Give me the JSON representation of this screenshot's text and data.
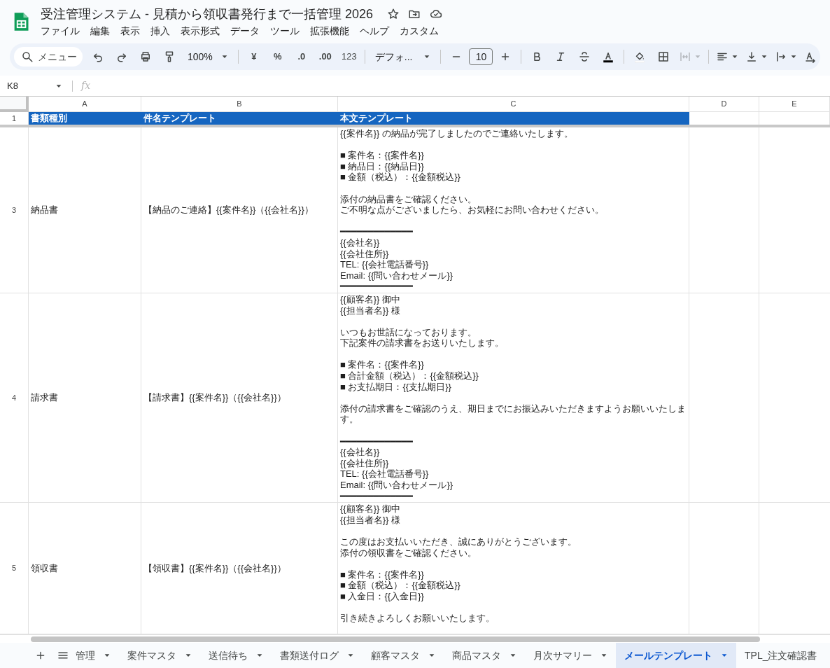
{
  "doc_title": "受注管理システム - 見積から領収書発行まで一括管理 2026",
  "menus": [
    "ファイル",
    "編集",
    "表示",
    "挿入",
    "表示形式",
    "データ",
    "ツール",
    "拡張機能",
    "ヘルプ",
    "カスタム"
  ],
  "toolbar": {
    "search_placeholder": "メニュー",
    "zoom": "100%",
    "currency": "¥",
    "percent": "%",
    "decimal_decrease": ".0",
    "decimal_increase": ".00",
    "number_format": "123",
    "font": "デフォ...",
    "font_size": "10"
  },
  "name_box": "K8",
  "formula_label": "fx",
  "columns": [
    "A",
    "B",
    "C",
    "D",
    "E"
  ],
  "header_row": {
    "number": "1",
    "cells": [
      "書類種別",
      "件名テンプレート",
      "本文テンプレート"
    ]
  },
  "rows": [
    {
      "number": "3",
      "type": "納品書",
      "subject": "【納品のご連絡】{{案件名}}（{{会社名}}）",
      "body": [
        [
          "{{案件名}} の納品が完了しましたのでご連絡いたします。"
        ],
        [
          "■ 案件名：{{案件名}}",
          "■ 納品日：{{納品日}}",
          "■ 金額（税込）：{{金額税込}}"
        ],
        [
          "添付の納品書をご確認ください。",
          "ご不明な点がございましたら、お気軽にお問い合わせください。"
        ],
        [
          "━━━━━━━━━━━━━",
          "{{会社名}}",
          "{{会社住所}}",
          "TEL: {{会社電話番号}}",
          "Email: {{問い合わせメール}}",
          "━━━━━━━━━━━━━"
        ]
      ]
    },
    {
      "number": "4",
      "type": "請求書",
      "subject": "【請求書】{{案件名}}（{{会社名}}）",
      "body": [
        [
          "{{顧客名}} 御中",
          "{{担当者名}} 様"
        ],
        [
          "いつもお世話になっております。",
          "下記案件の請求書をお送りいたします。"
        ],
        [
          "■ 案件名：{{案件名}}",
          "■ 合計金額（税込）：{{金額税込}}",
          "■ お支払期日：{{支払期日}}"
        ],
        [
          "添付の請求書をご確認のうえ、期日までにお振込みいただきますようお願いいたします。"
        ],
        [
          "━━━━━━━━━━━━━",
          "{{会社名}}",
          "{{会社住所}}",
          "TEL: {{会社電話番号}}",
          "Email: {{問い合わせメール}}",
          "━━━━━━━━━━━━━"
        ]
      ]
    },
    {
      "number": "5",
      "type": "領収書",
      "subject": "【領収書】{{案件名}}（{{会社名}}）",
      "body": [
        [
          "{{顧客名}} 御中",
          "{{担当者名}} 様"
        ],
        [
          "この度はお支払いいただき、誠にありがとうございます。",
          "添付の領収書をご確認ください。"
        ],
        [
          "■ 案件名：{{案件名}}",
          "■ 金額（税込）：{{金額税込}}",
          "■ 入金日：{{入金日}}"
        ],
        [
          "引き続きよろしくお願いいたします。"
        ]
      ]
    }
  ],
  "sheet_tabs": [
    {
      "label": "管理",
      "selected": false
    },
    {
      "label": "案件マスタ",
      "selected": false
    },
    {
      "label": "送信待ち",
      "selected": false
    },
    {
      "label": "書類送付ログ",
      "selected": false
    },
    {
      "label": "顧客マスタ",
      "selected": false
    },
    {
      "label": "商品マスタ",
      "selected": false
    },
    {
      "label": "月次サマリー",
      "selected": false
    },
    {
      "label": "メールテンプレート",
      "selected": true
    },
    {
      "label": "TPL_注文確認書",
      "selected": false
    }
  ]
}
